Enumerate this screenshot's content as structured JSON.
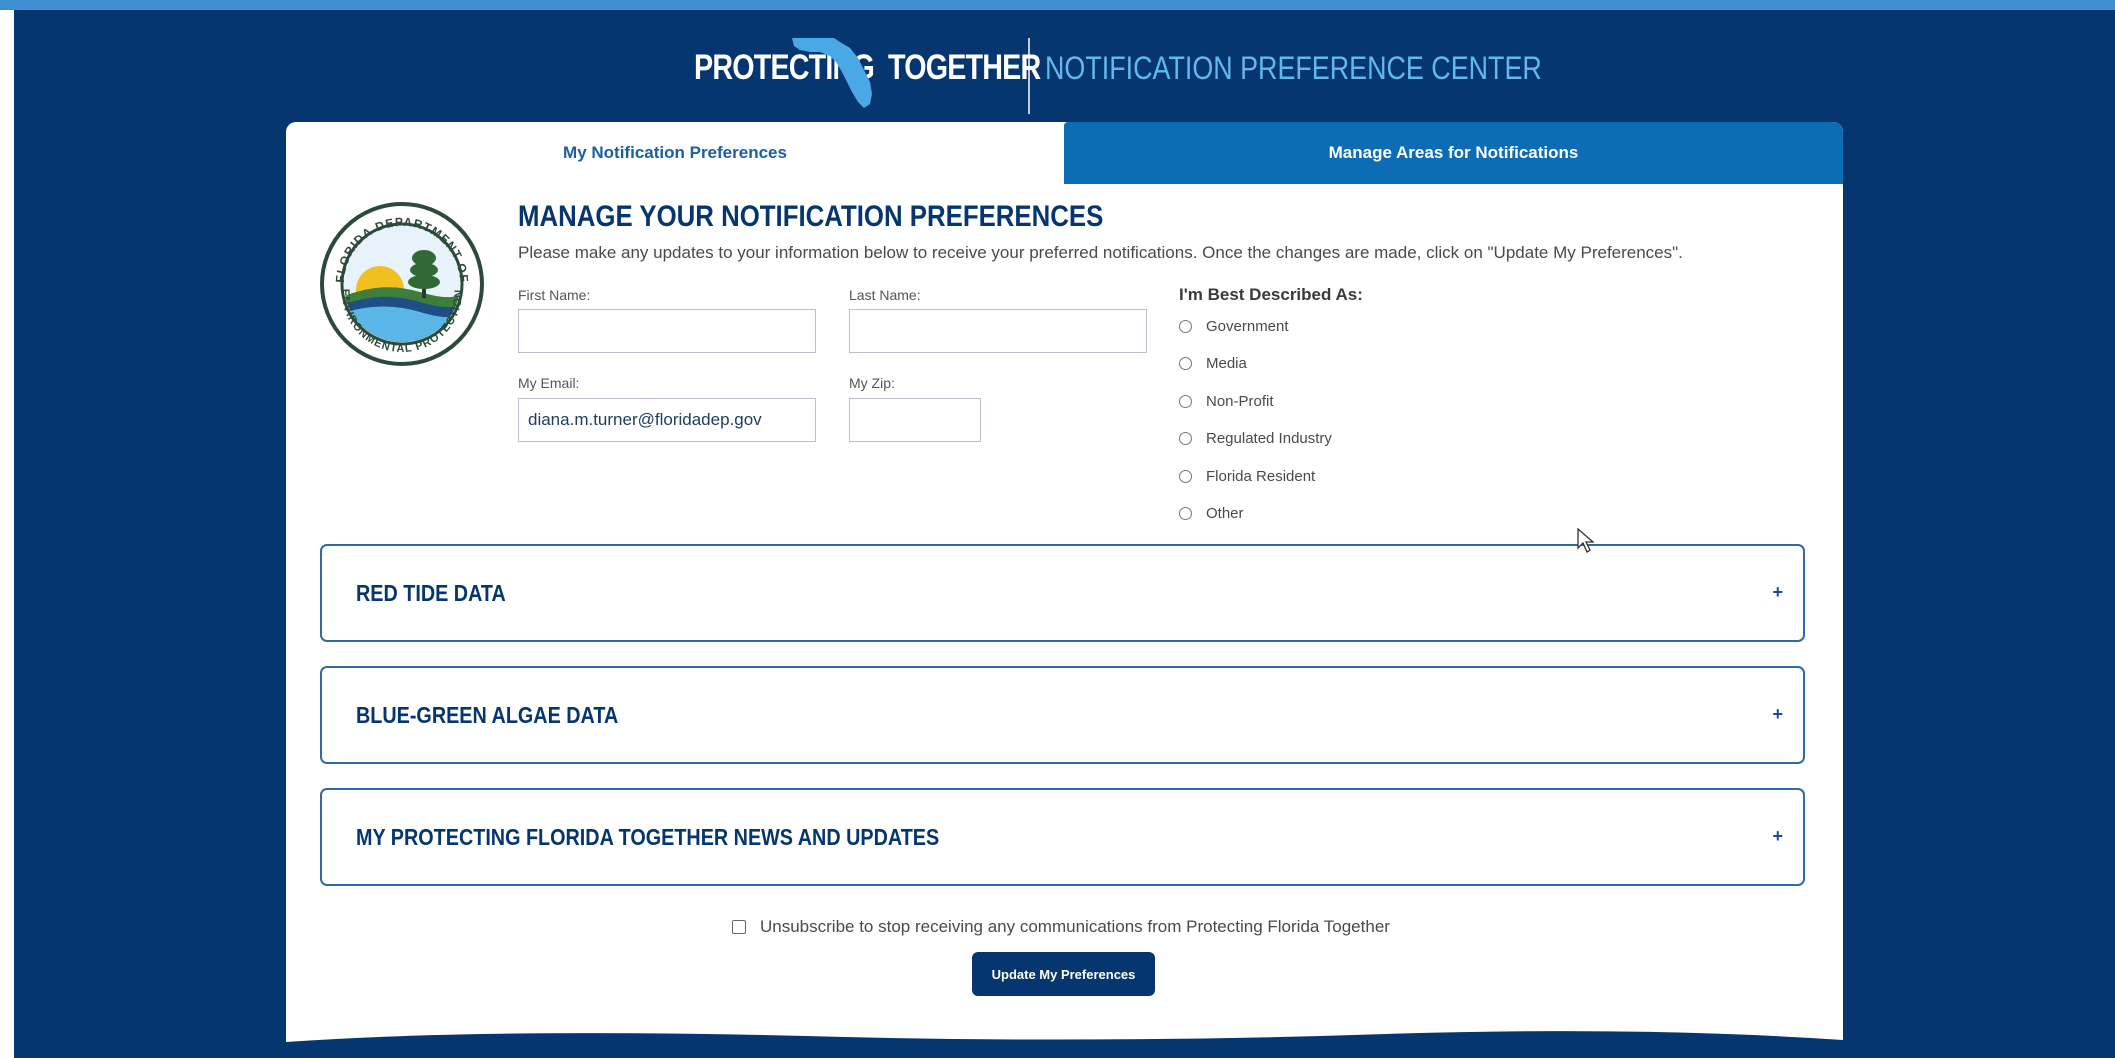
{
  "header": {
    "brand_left": "PROTECTING",
    "brand_right": "TOGETHER",
    "subtitle": "NOTIFICATION PREFERENCE CENTER"
  },
  "tabs": {
    "active": "My Notification Preferences",
    "inactive": "Manage Areas for Notifications"
  },
  "form": {
    "heading": "MANAGE YOUR NOTIFICATION PREFERENCES",
    "instructions": "Please make any updates to your information below to receive your preferred notifications. Once the changes are made, click on \"Update My Preferences\".",
    "first_name_label": "First Name:",
    "first_name_value": "",
    "last_name_label": "Last Name:",
    "last_name_value": "",
    "email_label": "My Email:",
    "email_value": "diana.m.turner@floridadep.gov",
    "zip_label": "My Zip:",
    "zip_value": ""
  },
  "described_as": {
    "title": "I'm Best Described As:",
    "options": [
      "Government",
      "Media",
      "Non-Profit",
      "Regulated Industry",
      "Florida Resident",
      "Other"
    ]
  },
  "sections": [
    {
      "title": "RED TIDE DATA",
      "toggle": "+"
    },
    {
      "title": "BLUE-GREEN ALGAE DATA",
      "toggle": "+"
    },
    {
      "title": "MY PROTECTING FLORIDA TOGETHER NEWS AND UPDATES",
      "toggle": "+"
    }
  ],
  "unsubscribe_label": "Unsubscribe to stop receiving any communications from Protecting Florida Together",
  "update_button": "Update My Preferences",
  "seal_text": {
    "top": "FLORIDA DEPARTMENT OF",
    "bottom": "ENVIRONMENTAL PROTECTION"
  },
  "colors": {
    "navy": "#06366f",
    "tab_blue": "#0c6db5",
    "light_blue": "#63b7ef",
    "strip": "#3e8fd2"
  }
}
